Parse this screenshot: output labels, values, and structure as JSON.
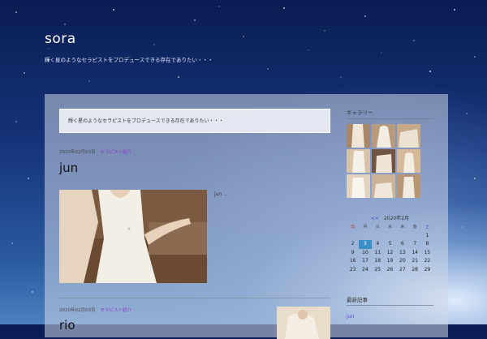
{
  "site": {
    "title": "sora",
    "tagline": "輝く星のようなセラピストをプロデュースできる存在でありたい・・・"
  },
  "notice": "輝く星のようなセラピストをプロデュースできる存在でありたい・・・",
  "posts": [
    {
      "date": "2020年02月03日",
      "category": "セラピスト紹介",
      "title": "jun",
      "excerpt": "jun ..."
    },
    {
      "date": "2020年02月03日",
      "category": "セラピスト紹介",
      "title": "rio"
    }
  ],
  "sidebar": {
    "gallery_title": "ギャラリー",
    "calendar": {
      "prev": "<<",
      "month": "2020年2月",
      "weekdays": [
        "日",
        "月",
        "火",
        "水",
        "木",
        "金",
        "土"
      ],
      "today": 3,
      "weeks": [
        [
          "",
          "",
          "",
          "",
          "",
          "",
          "1"
        ],
        [
          "2",
          "3",
          "4",
          "5",
          "6",
          "7",
          "8"
        ],
        [
          "9",
          "10",
          "11",
          "12",
          "13",
          "14",
          "15"
        ],
        [
          "16",
          "17",
          "18",
          "19",
          "20",
          "21",
          "22"
        ],
        [
          "23",
          "24",
          "25",
          "26",
          "27",
          "28",
          "29"
        ]
      ]
    },
    "recent_title": "最新記事",
    "recent_items": [
      "jun"
    ]
  },
  "colors": {
    "accent_link": "#5a3bd6",
    "category": "#8a3ec8",
    "today_highlight": "#3a8fc7"
  }
}
